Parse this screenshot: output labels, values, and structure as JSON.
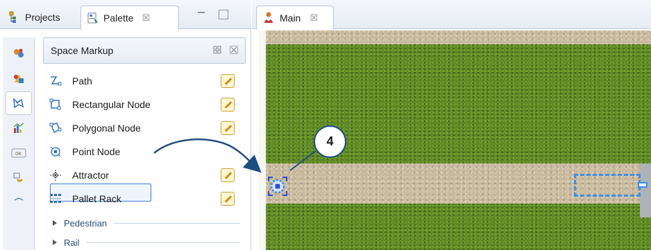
{
  "left_view": {
    "tabs": [
      {
        "label": "Projects",
        "icon": "projects-icon"
      },
      {
        "label": "Palette",
        "icon": "palette-icon",
        "close": "☒"
      }
    ]
  },
  "palette": {
    "section_title": "Space Markup",
    "items": [
      {
        "label": "Path",
        "icon": "path-icon",
        "editable": true
      },
      {
        "label": "Rectangular Node",
        "icon": "rectangular-node-icon",
        "editable": true
      },
      {
        "label": "Polygonal Node",
        "icon": "polygonal-node-icon",
        "editable": true
      },
      {
        "label": "Point Node",
        "icon": "point-node-icon",
        "editable": false,
        "selected": true
      },
      {
        "label": "Attractor",
        "icon": "attractor-icon",
        "editable": true
      },
      {
        "label": "Pallet Rack",
        "icon": "pallet-rack-icon",
        "editable": true
      }
    ],
    "groups": [
      "Pedestrian",
      "Rail"
    ]
  },
  "strip_icons": [
    "agent-icon",
    "presentation-icon",
    "space-markup-icon",
    "analysis-icon",
    "controls-icon",
    "connectivity-icon",
    "more-icon"
  ],
  "editor": {
    "tab_label": "Main",
    "tab_close": "☒"
  },
  "callout": {
    "number": "4"
  },
  "colors": {
    "selection_blue": "#3e8ee8",
    "callout_border": "#1f4e80",
    "grass": "#5e8a26",
    "sand": "#c8b99c"
  }
}
